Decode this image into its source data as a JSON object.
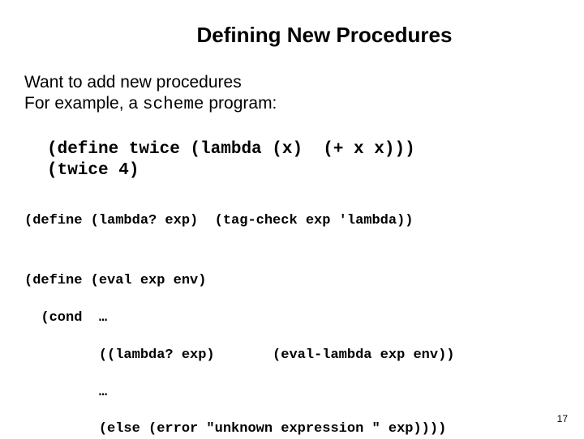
{
  "title": "Defining New Procedures",
  "intro": {
    "line1": "Want to add new procedures",
    "line2_pre": "For example, a ",
    "line2_code": "scheme",
    "line2_post": " program:"
  },
  "code1": {
    "line1": "(define twice (lambda (x)  (+ x x)))",
    "line2": "(twice 4)"
  },
  "code2": {
    "line1": "(define (lambda? exp)  (tag-check exp 'lambda))",
    "line3": "(define (eval exp env)",
    "line4": "  (cond  …",
    "line5": "         ((lambda? exp)       (eval-lambda exp env))",
    "line6": "         …",
    "line7": "         (else (error \"unknown expression \" exp))))"
  },
  "pagenum": "17"
}
